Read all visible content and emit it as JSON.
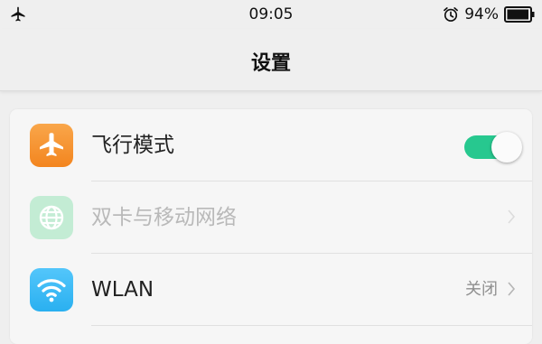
{
  "status_bar": {
    "time": "09:05",
    "battery_percent": "94%",
    "airplane_icon": "airplane-icon",
    "alarm_icon": "alarm-clock-icon",
    "battery_icon": "battery-icon",
    "battery_level": 0.94
  },
  "header": {
    "title": "设置"
  },
  "settings": {
    "items": [
      {
        "label": "飞行模式",
        "icon": "airplane-icon",
        "icon_color": "#f58a1f",
        "toggle_on": true,
        "toggle_color": "#27c88f"
      },
      {
        "label": "双卡与移动网络",
        "icon": "globe-icon",
        "icon_color": "#bfe9d0",
        "disabled": true
      },
      {
        "label": "WLAN",
        "icon": "wifi-icon",
        "icon_color": "#35b7f2",
        "value": "关闭"
      }
    ]
  }
}
